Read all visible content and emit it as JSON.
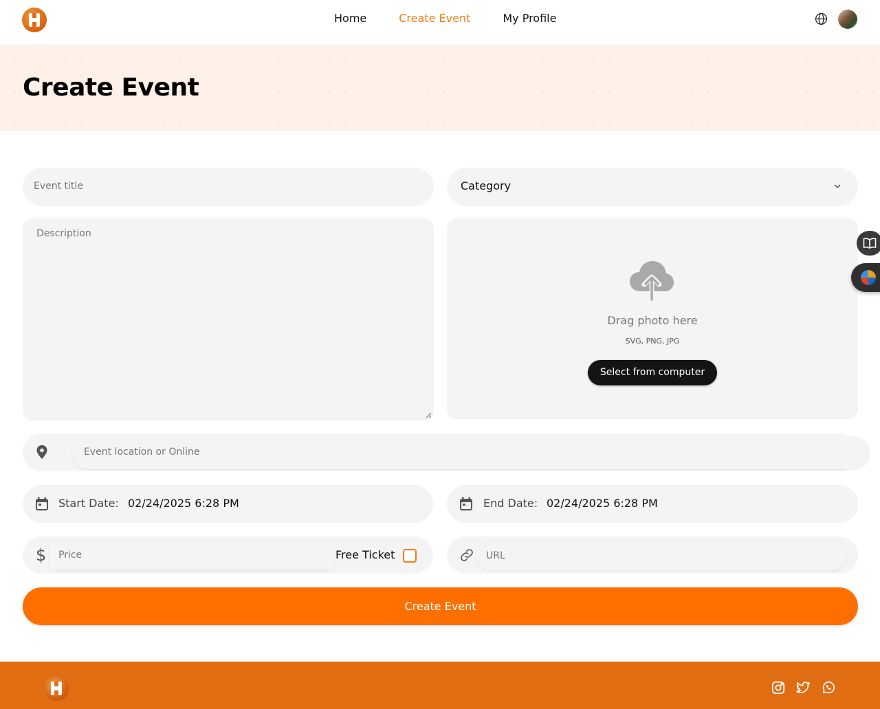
{
  "nav": {
    "links": [
      "Home",
      "Create Event",
      "My Profile"
    ],
    "active": "Create Event"
  },
  "icons": {
    "logo": "logo-icon",
    "language": "globe-icon",
    "avatar": "user-avatar",
    "category_toggle": "chevron-down-icon",
    "upload": "cloud-upload-icon",
    "location": "map-pin-icon",
    "date": "calendar-icon",
    "price": "dollar-icon",
    "url": "link-icon",
    "social": [
      "instagram-icon",
      "twitter-icon",
      "whatsapp-icon"
    ]
  },
  "page": {
    "title": "Create Event"
  },
  "form": {
    "title_placeholder": "Event title",
    "category_value": "Category",
    "description_placeholder": "Description",
    "upload": {
      "drag_text": "Drag photo here",
      "formats": "SVG, PNG, JPG",
      "button_label": "Select from computer"
    },
    "location_placeholder": "Event location or Online",
    "start_label": "Start Date:",
    "start_value": "02/24/2025 6:28 PM",
    "end_label": "End Date:",
    "end_value": "02/24/2025 6:28 PM",
    "price_symbol": "$",
    "price_placeholder": "Price",
    "free_ticket_label": "Free Ticket",
    "free_ticket_checked": false,
    "url_placeholder": "URL",
    "submit_label": "Create Event"
  },
  "colors": {
    "accent": "#ff6f00",
    "footer": "#e06d12",
    "hero_bg": "#fff1e7",
    "field_bg": "#f4f4f4"
  }
}
